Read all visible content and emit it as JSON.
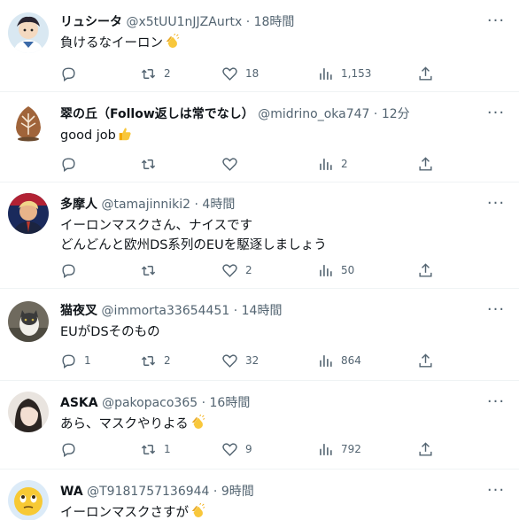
{
  "tweets": [
    {
      "name": "リュシータ",
      "handle": "@x5tUU1nJJZAurtx",
      "sep": "·",
      "time": "18時間",
      "lines": [
        "負けるなイーロン"
      ],
      "emoji": "clapping-hands",
      "replies": "",
      "retweets": "2",
      "likes": "18",
      "views": "1,153"
    },
    {
      "name": "翠の丘（Follow返しは常でなし）",
      "handle": "@midrino_oka747",
      "sep": "·",
      "time": "12分",
      "lines": [
        "good job"
      ],
      "emoji": "thumbs-up",
      "replies": "",
      "retweets": "",
      "likes": "",
      "views": "2"
    },
    {
      "name": "多摩人",
      "handle": "@tamajinniki2",
      "sep": "·",
      "time": "4時間",
      "lines": [
        "イーロンマスクさん、ナイスです",
        "どんどんと欧州DS系列のEUを駆逐しましょう"
      ],
      "emoji": "",
      "replies": "",
      "retweets": "",
      "likes": "2",
      "views": "50"
    },
    {
      "name": "猫夜叉",
      "handle": "@immorta33654451",
      "sep": "·",
      "time": "14時間",
      "lines": [
        "EUがDSそのもの"
      ],
      "emoji": "",
      "replies": "1",
      "retweets": "2",
      "likes": "32",
      "views": "864"
    },
    {
      "name": "ASKA",
      "handle": "@pakopaco365",
      "sep": "·",
      "time": "16時間",
      "lines": [
        "あら、マスクやりよる"
      ],
      "emoji": "clapping-hands",
      "replies": "",
      "retweets": "1",
      "likes": "9",
      "views": "792"
    },
    {
      "name": "WA",
      "handle": "@T9181757136944",
      "sep": "·",
      "time": "9時間",
      "lines": [
        "イーロンマスクさすが"
      ],
      "emoji": "clapping-hands",
      "replies": "",
      "retweets": "",
      "likes": "",
      "views": ""
    }
  ],
  "colors": {
    "text": "#0f1419",
    "muted": "#536471",
    "divider": "#eff3f4",
    "background": "#ffffff"
  },
  "icons": {
    "more": "more-horizontal-icon",
    "reply": "reply-icon",
    "retweet": "retweet-icon",
    "like": "heart-icon",
    "views": "views-bar-chart-icon",
    "share": "share-icon"
  }
}
